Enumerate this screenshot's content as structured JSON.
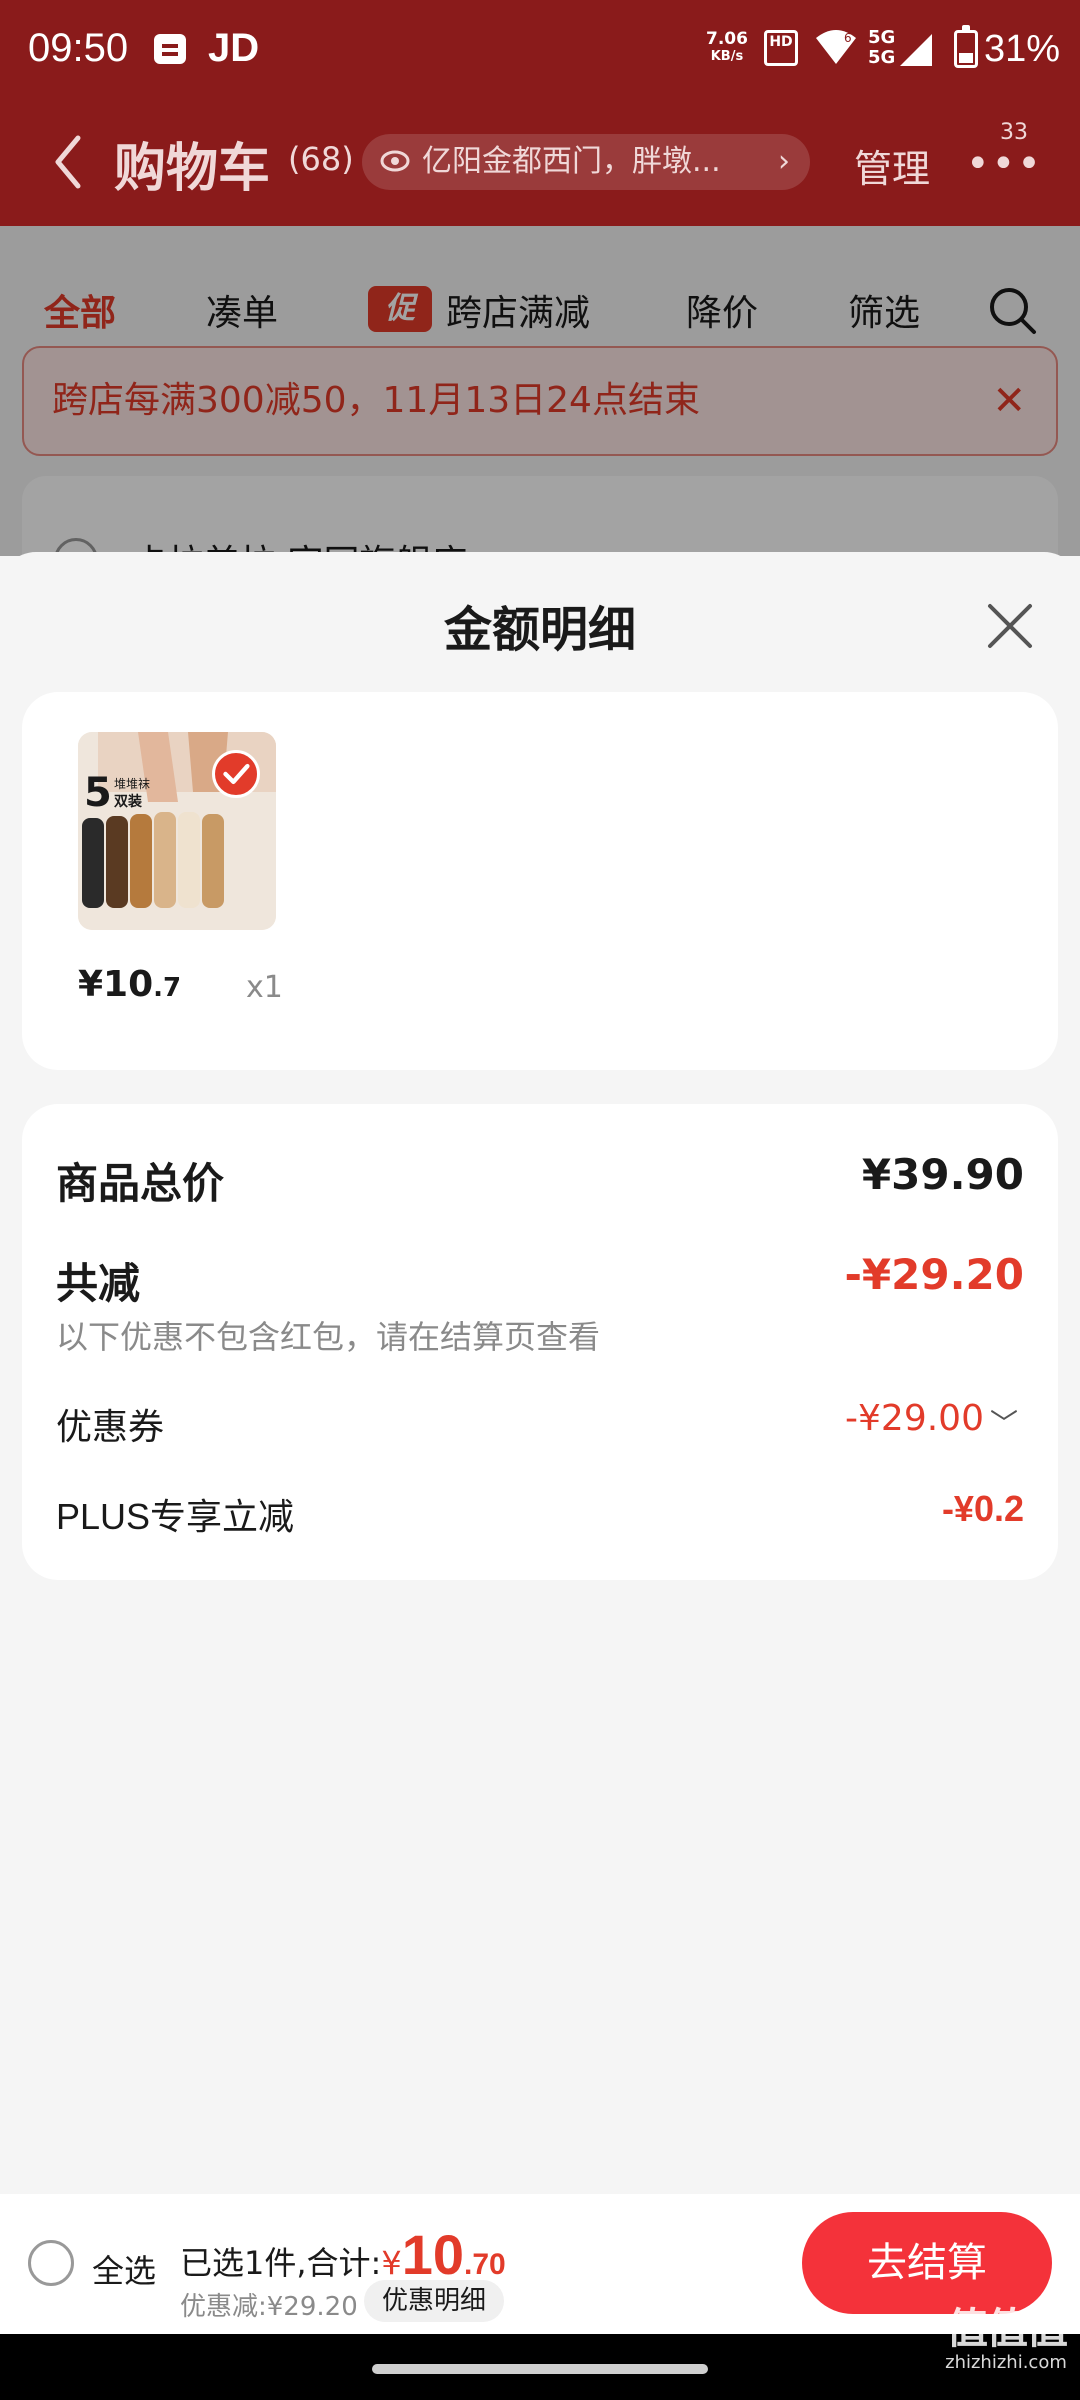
{
  "status_bar": {
    "time": "09:50",
    "app_label": "JD",
    "net_speed_value": "7.06",
    "net_speed_unit": "KB/s",
    "hd_label": "HD",
    "signal_label_1": "5G",
    "signal_label_2": "5G",
    "wifi_sub": "6",
    "battery": "31%"
  },
  "header": {
    "title": "购物车",
    "count": "(68)",
    "address": "亿阳金都西门，胖墩...",
    "manage": "管理",
    "badge": "33"
  },
  "tabs": [
    {
      "label": "全部"
    },
    {
      "label": "凑单"
    },
    {
      "label": "跨店满减",
      "tag": "促"
    },
    {
      "label": "降价"
    },
    {
      "label": "筛选"
    }
  ],
  "promo_banner": "跨店每满300减50，11月13日24点结束",
  "shop_name_partial": "卡拉美拉 官网旗舰店 >",
  "sheet": {
    "title": "金额明细",
    "goods": [
      {
        "price_main": "¥10",
        "price_dec": ".7",
        "qty": "x1",
        "image_text_num": "5",
        "image_text_1": "堆堆袜",
        "image_text_2": "双装"
      }
    ],
    "summary": {
      "total_label": "商品总价",
      "total_value": "¥39.90",
      "reduce_label": "共减",
      "reduce_value": "-¥29.20",
      "note": "以下优惠不包含红包，请在结算页查看",
      "coupon_label": "优惠券",
      "coupon_value": "-¥29.00",
      "plus_label": "PLUS专享立减",
      "plus_value": "-¥0.2"
    }
  },
  "bottom_bar": {
    "select_all": "全选",
    "selected_text": "已选1件,合计:",
    "currency": "¥",
    "amount_int": "10",
    "amount_dec": ".70",
    "discount_text": "优惠减:¥29.20",
    "detail_button": "优惠明细",
    "checkout": "去结算"
  },
  "watermark": {
    "logo": "值值值",
    "url": "zhizhizhi.com"
  },
  "colors": {
    "brand_red": "#e23b2a",
    "header_bg": "#8a1b1b",
    "checkout_bg": "#f4323a"
  }
}
